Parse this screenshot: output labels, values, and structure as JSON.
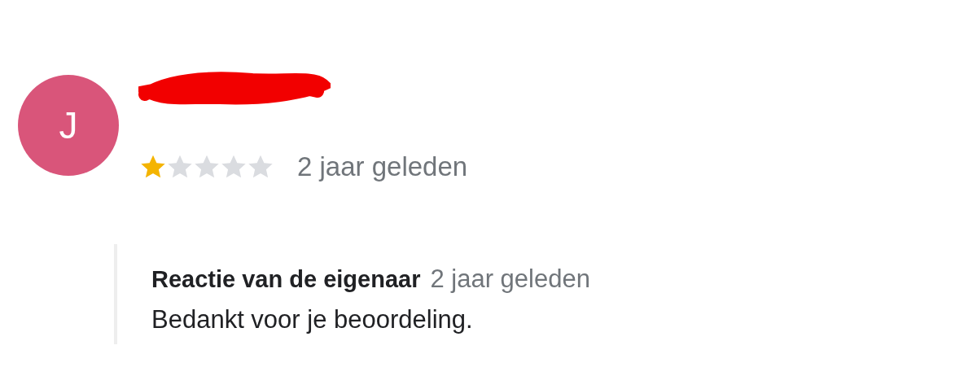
{
  "reviewer": {
    "avatar_letter": "J",
    "stars": 1,
    "time": "2 jaar geleden"
  },
  "owner_response": {
    "label": "Reactie van de eigenaar",
    "time": "2 jaar geleden",
    "text": "Bedankt voor je beoordeling."
  }
}
